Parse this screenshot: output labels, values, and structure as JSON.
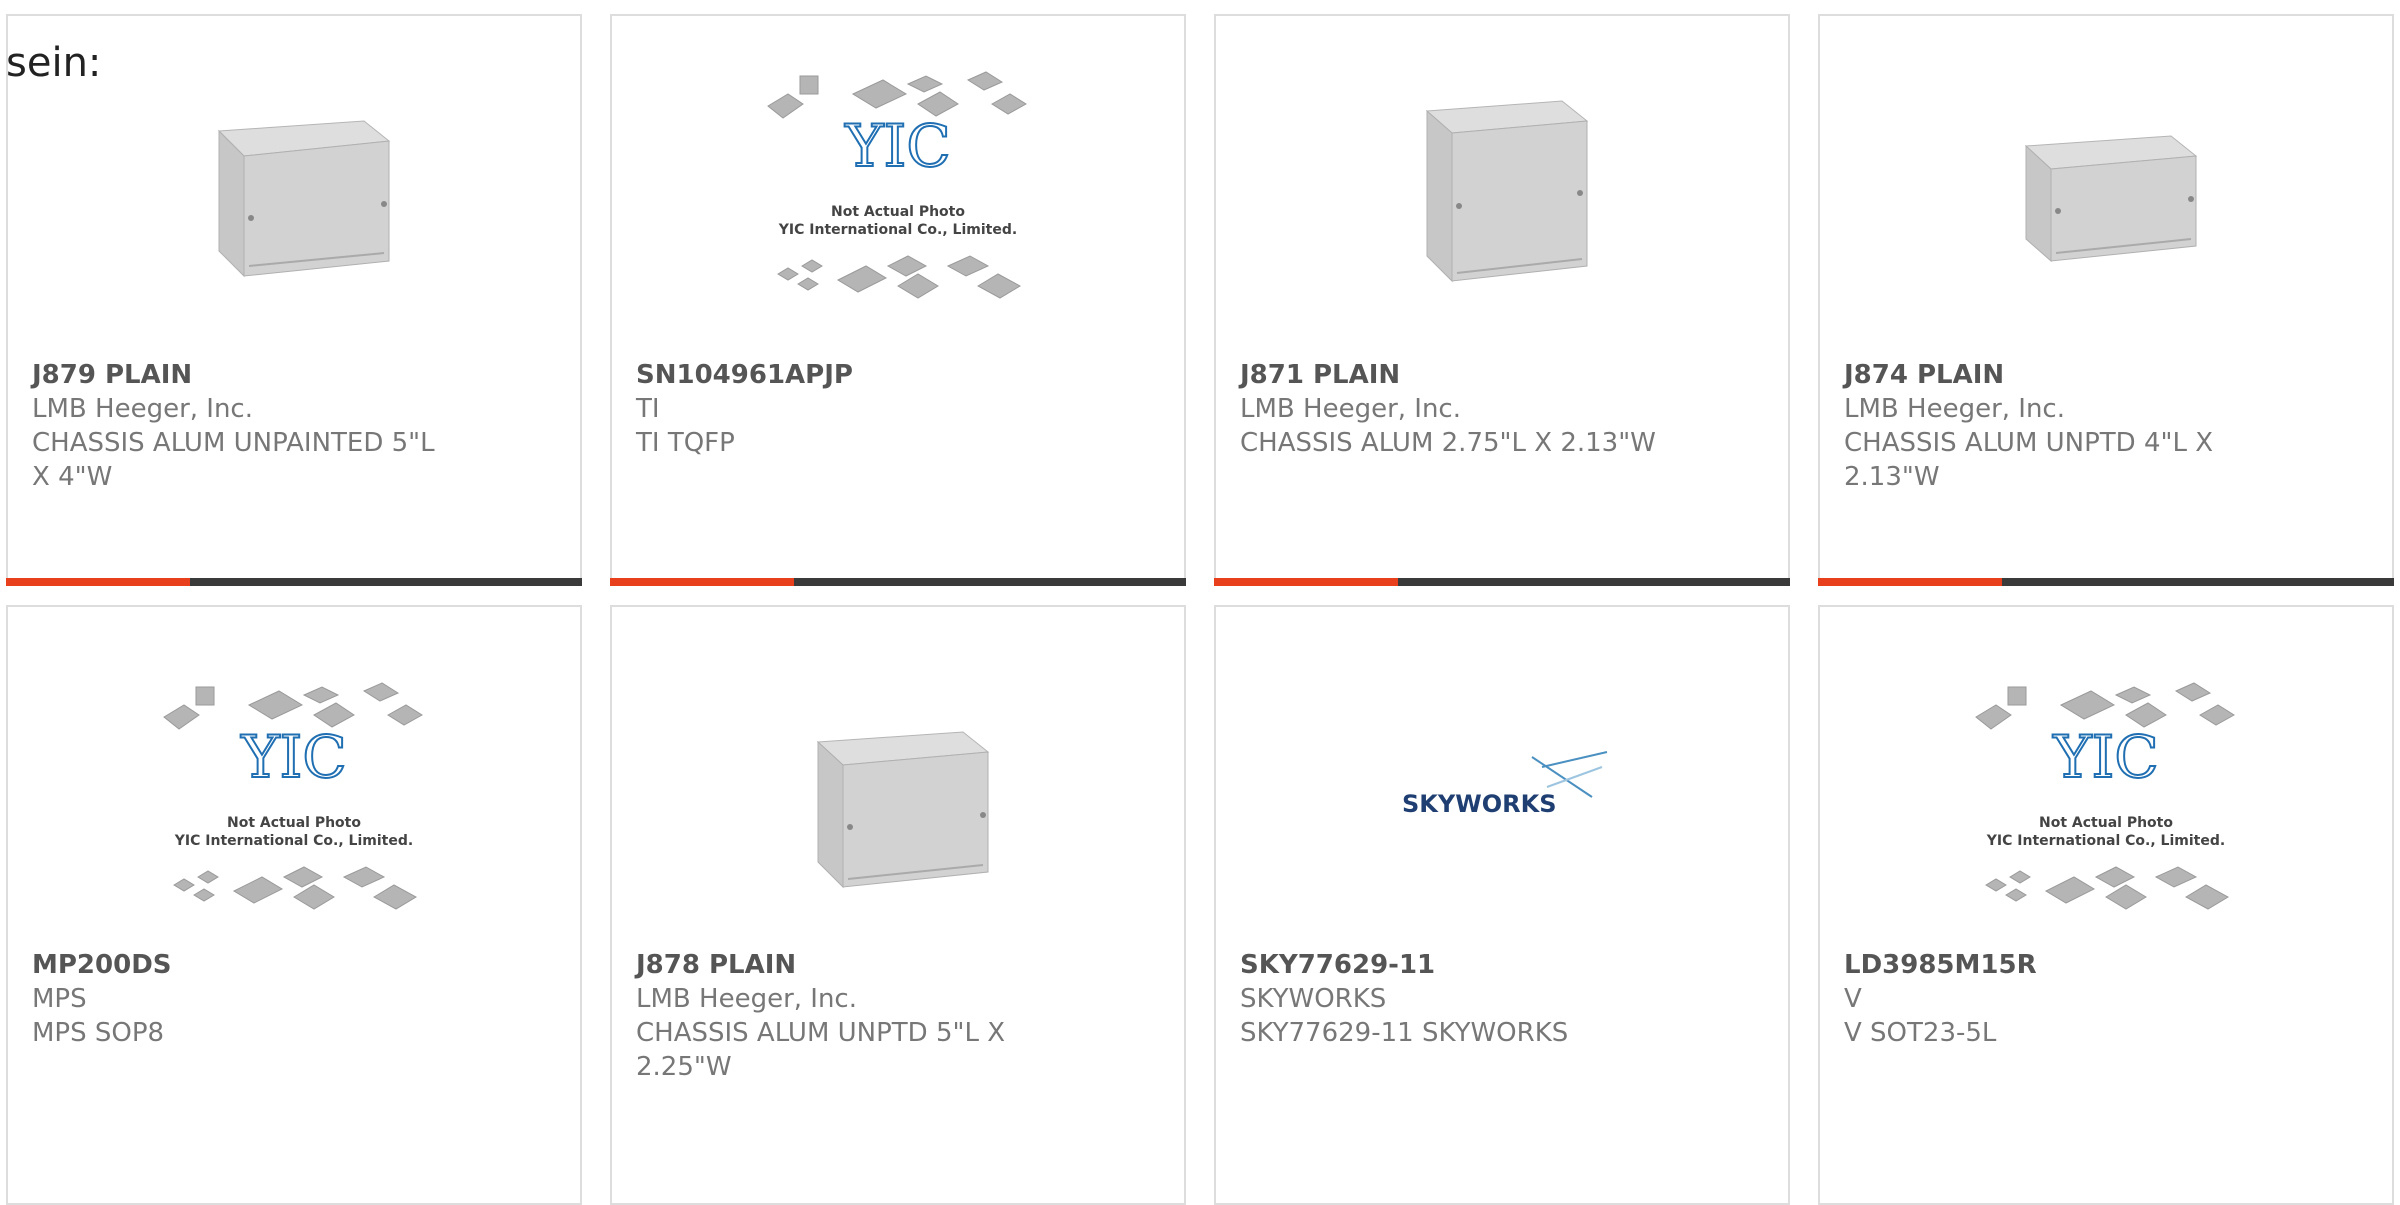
{
  "intro_text": "sein:",
  "products": [
    {
      "part_number": "J879 PLAIN",
      "manufacturer": "LMB Heeger, Inc.",
      "description": "CHASSIS ALUM UNPAINTED 5\"L X 4\"W",
      "image": "aluminum-chassis-box",
      "accent_color": "#e8401c"
    },
    {
      "part_number": "SN104961APJP",
      "manufacturer": "TI",
      "description": "TI TQFP",
      "image": "yic-not-actual-photo-placeholder",
      "placeholder_text": [
        "Not Actual Photo",
        "YIC International Co., Limited."
      ],
      "logo_text": "YIC",
      "accent_color": "#e8401c"
    },
    {
      "part_number": "J871 PLAIN",
      "manufacturer": "LMB Heeger, Inc.",
      "description": "CHASSIS ALUM 2.75\"L X 2.13\"W",
      "image": "aluminum-chassis-box-tall",
      "accent_color": "#e8401c"
    },
    {
      "part_number": "J874 PLAIN",
      "manufacturer": "LMB Heeger, Inc.",
      "description": "CHASSIS ALUM UNPTD 4\"L X 2.13\"W",
      "image": "aluminum-chassis-box-wide",
      "accent_color": "#e8401c"
    },
    {
      "part_number": "MP200DS",
      "manufacturer": "MPS",
      "description": "MPS SOP8",
      "image": "yic-not-actual-photo-placeholder",
      "placeholder_text": [
        "Not Actual Photo",
        "YIC International Co., Limited."
      ],
      "logo_text": "YIC"
    },
    {
      "part_number": "J878 PLAIN",
      "manufacturer": "LMB Heeger, Inc.",
      "description": "CHASSIS ALUM UNPTD 5\"L X 2.25\"W",
      "image": "aluminum-chassis-box-wide"
    },
    {
      "part_number": "SKY77629-11",
      "manufacturer": "SKYWORKS",
      "description": "SKY77629-11 SKYWORKS",
      "image": "skyworks-logo",
      "logo_text": "SKYWORKS"
    },
    {
      "part_number": "LD3985M15R",
      "manufacturer": "V",
      "description": "V SOT23-5L",
      "image": "yic-not-actual-photo-placeholder",
      "placeholder_text": [
        "Not Actual Photo",
        "YIC International Co., Limited."
      ],
      "logo_text": "YIC"
    }
  ]
}
